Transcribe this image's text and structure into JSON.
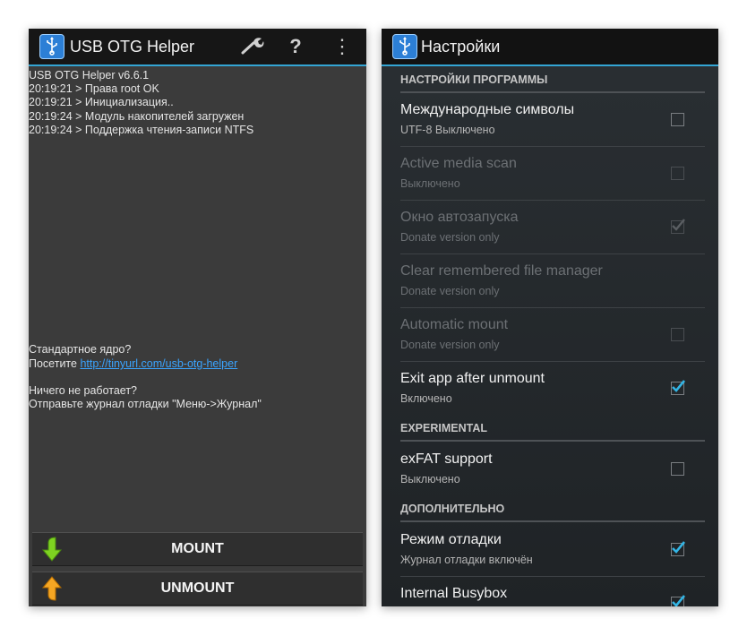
{
  "left_screen": {
    "app_title": "USB OTG Helper",
    "log_lines": [
      "USB OTG Helper v6.6.1",
      "20:19:21 > Права root OK",
      "20:19:21 > Инициализация..",
      "20:19:24 > Модуль накопителей загружен",
      "20:19:24 > Поддержка чтения-записи NTFS"
    ],
    "info": {
      "kernel_question": "Стандартное ядро?",
      "visit_label": "Посетите ",
      "visit_link": "http://tinyurl.com/usb-otg-helper",
      "not_working_question": "Ничего не работает?",
      "send_log_text": "Отправьте журнал отладки \"Меню->Журнал\""
    },
    "icons": {
      "settings": "wrench-icon",
      "help": "help-icon",
      "help_glyph": "?",
      "menu": "overflow-menu-icon",
      "menu_glyph": "⋮"
    },
    "buttons": {
      "mount_label": "MOUNT",
      "unmount_label": "UNMOUNT"
    },
    "colors": {
      "accent": "#33a5d4",
      "green_text": "#43e02b",
      "link": "#3aa4ff"
    }
  },
  "right_screen": {
    "title": "Настройки",
    "sections": [
      {
        "header": "НАСТРОЙКИ ПРОГРАММЫ"
      },
      {
        "header": "EXPERIMENTAL"
      },
      {
        "header": "ДОПОЛНИТЕЛЬНО"
      }
    ],
    "settings": [
      {
        "title": "Международные символы",
        "summary": "UTF-8 Выключено",
        "checked": false,
        "enabled": true
      },
      {
        "title": "Active media scan",
        "summary": "Выключено",
        "checked": false,
        "enabled": false
      },
      {
        "title": "Окно автозапуска",
        "summary": "Donate version only",
        "checked": true,
        "enabled": false
      },
      {
        "title": "Clear remembered file manager",
        "summary": "Donate version only",
        "checked": false,
        "enabled": false
      },
      {
        "title": "Automatic mount",
        "summary": "Donate version only",
        "checked": false,
        "enabled": false
      },
      {
        "title": "Exit app after unmount",
        "summary": "Включено",
        "checked": true,
        "enabled": true
      },
      {
        "title": "exFAT support",
        "summary": "Выключено",
        "checked": false,
        "enabled": true
      },
      {
        "title": "Режим отладки",
        "summary": "Журнал отладки включён",
        "checked": true,
        "enabled": true
      },
      {
        "title": "Internal Busybox",
        "summary": "",
        "checked": true,
        "enabled": true
      }
    ]
  }
}
